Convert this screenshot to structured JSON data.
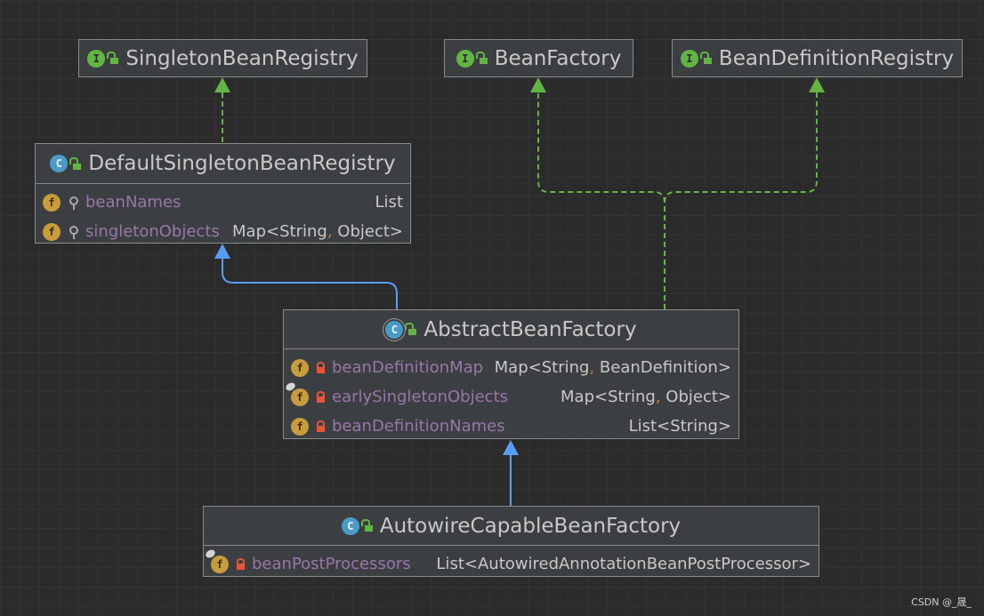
{
  "diagram": {
    "nodes": {
      "singleton_bean_registry": {
        "kind_badge": "I",
        "title": "SingletonBeanRegistry",
        "fields": []
      },
      "bean_factory": {
        "kind_badge": "I",
        "title": "BeanFactory",
        "fields": []
      },
      "bean_definition_registry": {
        "kind_badge": "I",
        "title": "BeanDefinitionRegistry",
        "fields": []
      },
      "default_singleton_bean_registry": {
        "kind_badge": "C",
        "title": "DefaultSingletonBeanRegistry",
        "fields": [
          {
            "badge": "f",
            "name": "beanNames",
            "type": "List"
          },
          {
            "badge": "f",
            "name": "singletonObjects",
            "type_pre": "Map<String",
            "type_sep": ",",
            "type_post": " Object>"
          }
        ]
      },
      "abstract_bean_factory": {
        "kind_badge": "C",
        "title": "AbstractBeanFactory",
        "fields": [
          {
            "badge": "f",
            "name": "beanDefinitionMap",
            "type_pre": "Map<String",
            "type_sep": ",",
            "type_post": " BeanDefinition>"
          },
          {
            "badge": "f",
            "name": "earlySingletonObjects",
            "type_pre": "Map<String",
            "type_sep": ",",
            "type_post": " Object>"
          },
          {
            "badge": "f",
            "name": "beanDefinitionNames",
            "type": "List<String>"
          }
        ]
      },
      "autowire_capable_bean_factory": {
        "kind_badge": "C",
        "title": "AutowireCapableBeanFactory",
        "fields": [
          {
            "badge": "f",
            "name": "beanPostProcessors",
            "type": "List<AutowiredAnnotationBeanPostProcessor>"
          }
        ]
      }
    },
    "edges": [
      {
        "from": "default_singleton_bean_registry",
        "to": "singleton_bean_registry",
        "kind": "implements"
      },
      {
        "from": "abstract_bean_factory",
        "to": "default_singleton_bean_registry",
        "kind": "extends"
      },
      {
        "from": "abstract_bean_factory",
        "to": "bean_factory",
        "kind": "implements"
      },
      {
        "from": "abstract_bean_factory",
        "to": "bean_definition_registry",
        "kind": "implements"
      },
      {
        "from": "autowire_capable_bean_factory",
        "to": "abstract_bean_factory",
        "kind": "extends"
      }
    ],
    "colors": {
      "background": "#2b2b2b",
      "node_fill": "#3c3f41",
      "node_border": "#8a8a8a",
      "implements_edge": "#62b543",
      "extends_edge": "#589df6",
      "field_name": "#9876aa",
      "type_text": "#c8c8c8"
    }
  },
  "watermark": "CSDN @_晟_"
}
